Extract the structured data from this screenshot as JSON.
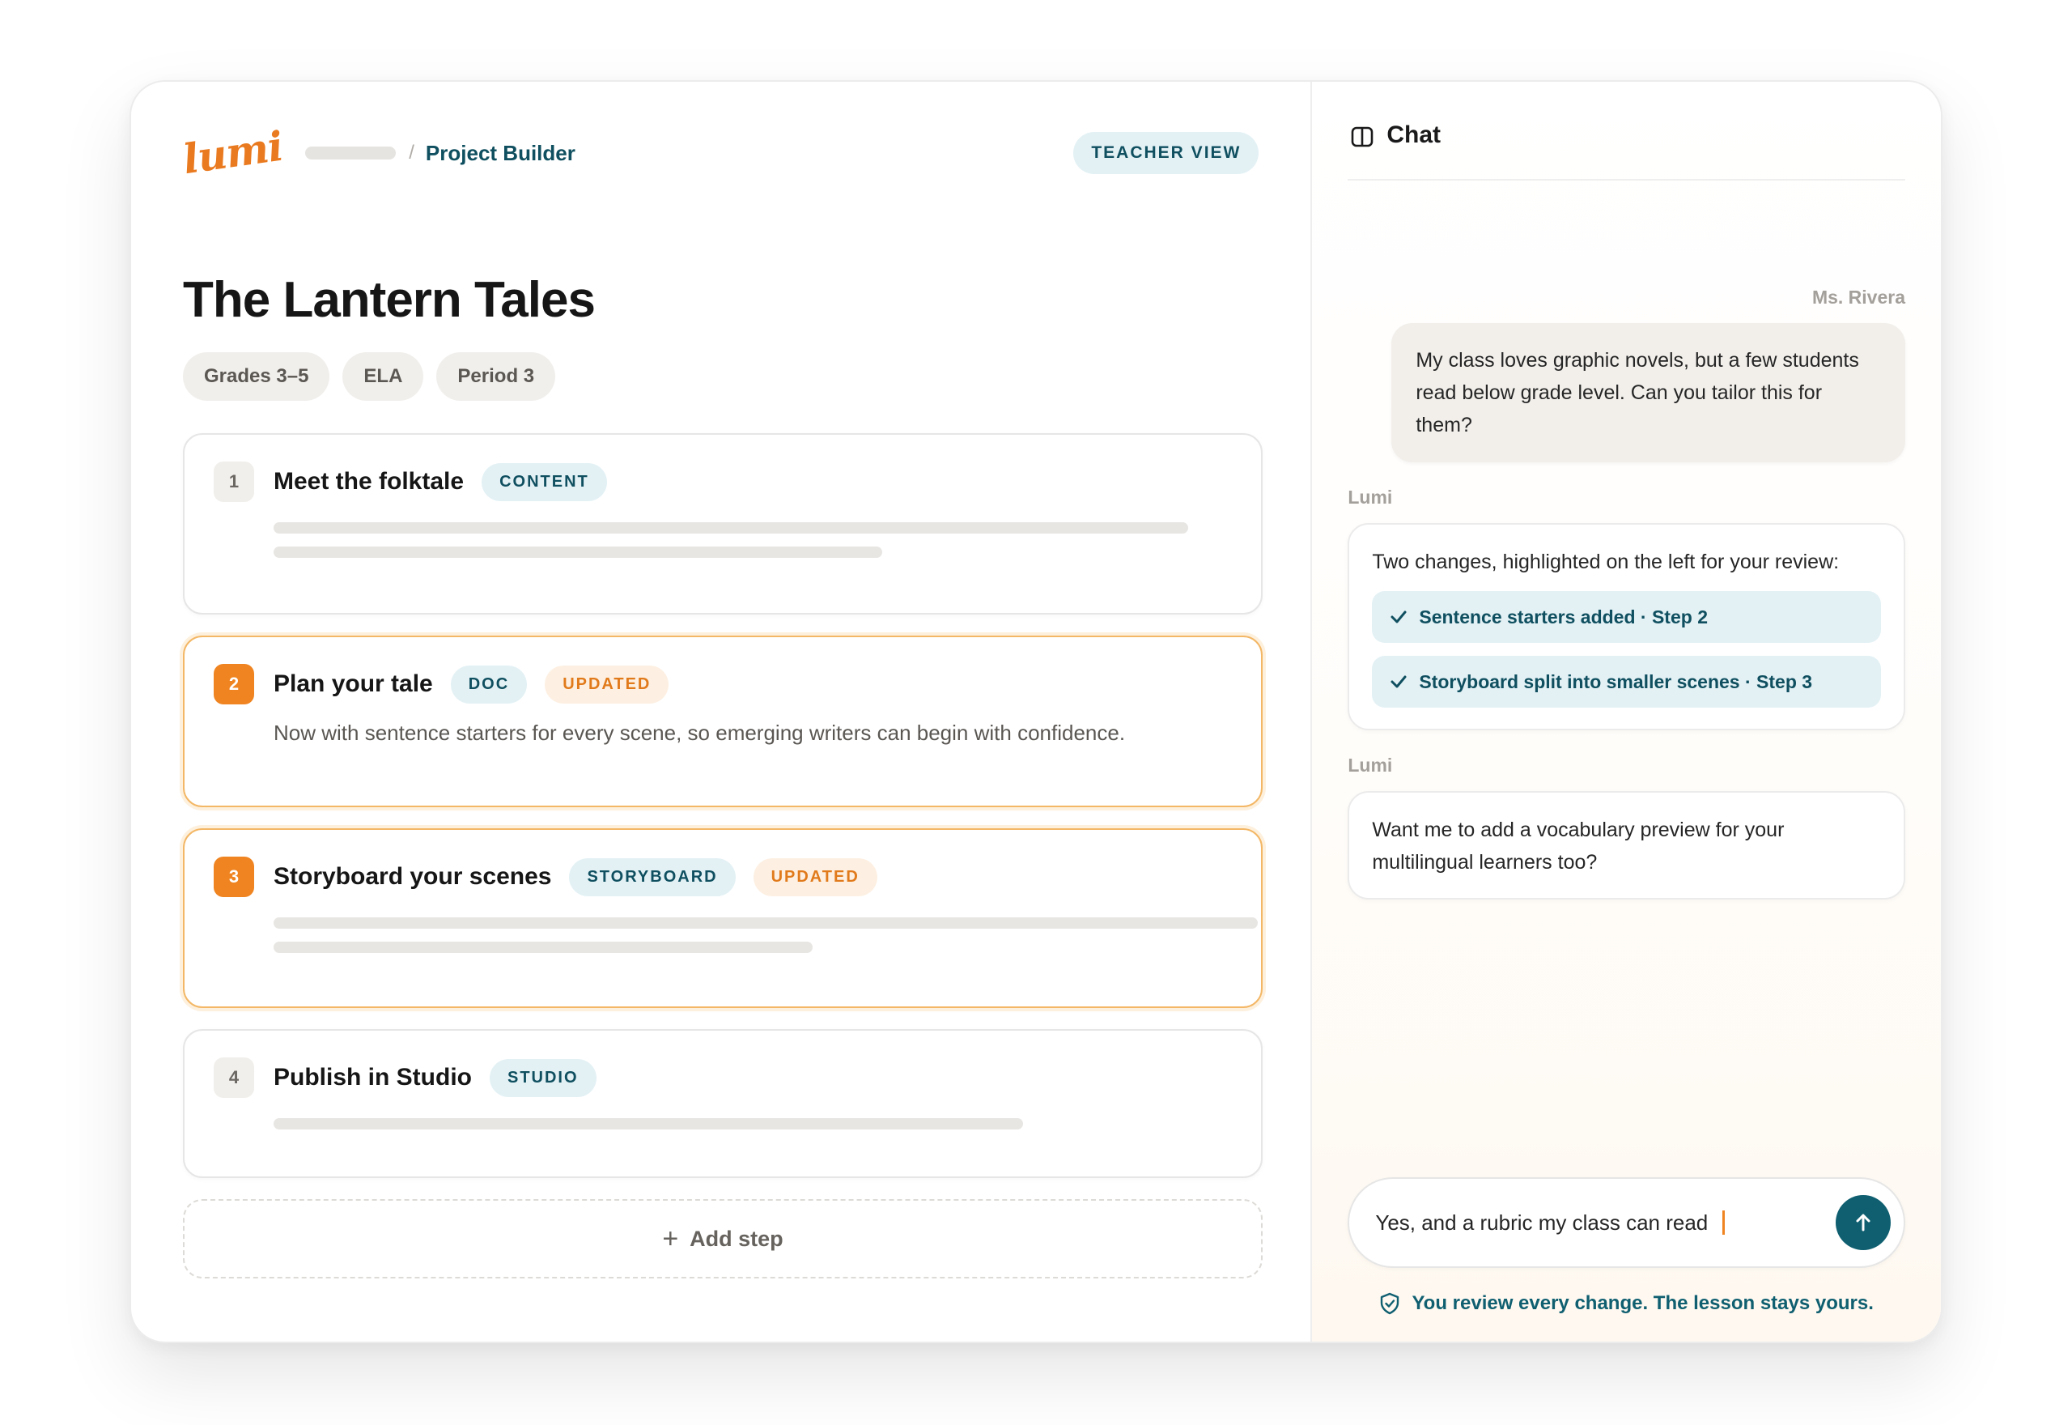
{
  "header": {
    "logo_text": "lumi",
    "breadcrumb_current": "Project Builder",
    "breadcrumb_separator": "/",
    "view_badge": "TEACHER VIEW"
  },
  "project": {
    "title": "The Lantern Tales",
    "tags": [
      "Grades 3–5",
      "ELA",
      "Period 3"
    ]
  },
  "steps": [
    {
      "number": "1",
      "title": "Meet the folktale",
      "type": "CONTENT",
      "updated_label": ""
    },
    {
      "number": "2",
      "title": "Plan your tale",
      "type": "DOC",
      "updated_label": "UPDATED",
      "description": "Now with sentence starters for every scene, so emerging writers can begin with confidence."
    },
    {
      "number": "3",
      "title": "Storyboard your scenes",
      "type": "STORYBOARD",
      "updated_label": "UPDATED"
    },
    {
      "number": "4",
      "title": "Publish in Studio",
      "type": "STUDIO",
      "updated_label": ""
    }
  ],
  "add_step_label": "Add step",
  "chat": {
    "title": "Chat",
    "messages": [
      {
        "sender": "Ms. Rivera",
        "text": "My class loves graphic novels, but a few students read below grade level. Can you tailor this for them?"
      },
      {
        "sender": "Lumi",
        "text": "Two changes, highlighted on the left for your review:",
        "changes": [
          "Sentence starters added · Step 2",
          "Storyboard split into smaller scenes · Step 3"
        ]
      },
      {
        "sender": "Lumi",
        "text": "Want me to add a vocabulary preview for your multilingual learners too?"
      }
    ],
    "composer_value": "Yes, and a rubric my class can read",
    "footer_note": "You review every change. The lesson stays yours."
  },
  "colors": {
    "accent_orange": "#ef8421",
    "accent_teal": "#0f5f70",
    "badge_teal_bg": "#e3f1f5"
  },
  "icons": {
    "panel": "sidebar-panel-icon",
    "check": "check-icon",
    "send": "arrow-up-icon",
    "shield": "shield-check-icon",
    "add": "plus-icon"
  }
}
